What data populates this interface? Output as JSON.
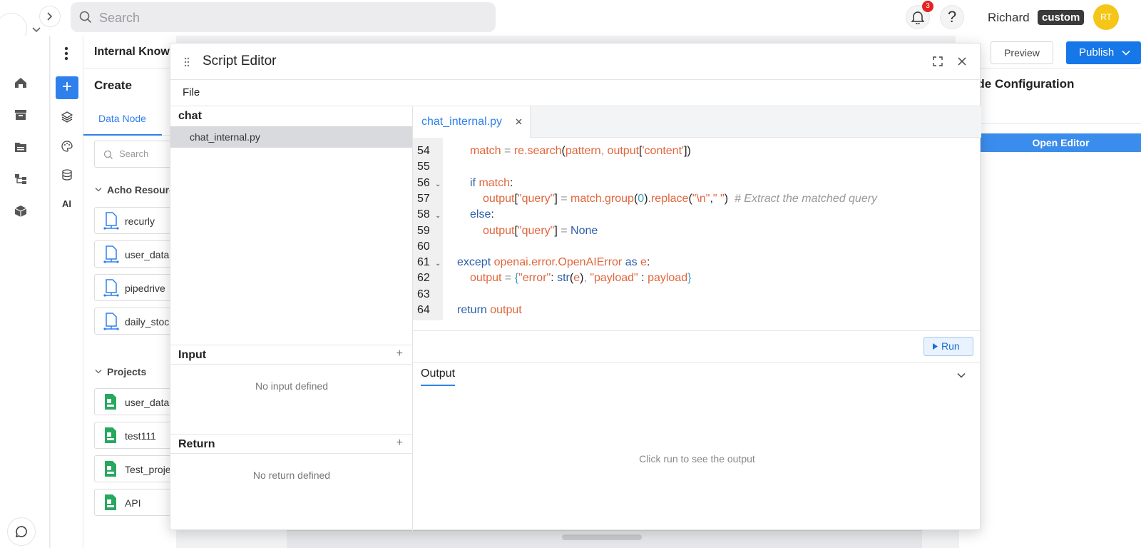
{
  "topbar": {
    "search_placeholder": "Search",
    "notifications_count": "3",
    "user_name": "Richard",
    "user_tag": "custom",
    "avatar_initials": "RT"
  },
  "app": {
    "title": "Internal Knowle",
    "create_label": "Create",
    "tab_data_node": "Data Node",
    "panel_search_placeholder": "Search"
  },
  "resources": {
    "header": "Acho Resources",
    "items": [
      "recurly",
      "user_data",
      "pipedrive",
      "daily_stoc"
    ]
  },
  "projects": {
    "header": "Projects",
    "items": [
      "user_data",
      "test111",
      "Test_proje",
      "API"
    ]
  },
  "rail2": {
    "ai_label": "AI"
  },
  "right": {
    "preview": "Preview",
    "publish": "Publish",
    "node_config": "ode Configuration",
    "open_editor": "Open Editor"
  },
  "editor": {
    "title": "Script Editor",
    "menu_file": "File",
    "folder": "chat",
    "file": "chat_internal.py",
    "tab_file": "chat_internal.py",
    "input_header": "Input",
    "input_empty": "No input defined",
    "return_header": "Return",
    "return_empty": "No return defined",
    "run": "Run",
    "output_tab": "Output",
    "output_placeholder": "Click run to see the output",
    "line_numbers": [
      "54",
      "55",
      "56",
      "57",
      "58",
      "59",
      "60",
      "61",
      "62",
      "63",
      "64"
    ],
    "lines": [
      {
        "indent": 1,
        "tokens": [
          [
            "v",
            "match"
          ],
          [
            "g",
            " = "
          ],
          [
            "v",
            "re.search"
          ],
          [
            "d",
            "("
          ],
          [
            "v",
            "pattern"
          ],
          [
            "g",
            ", "
          ],
          [
            "v",
            "output"
          ],
          [
            "d",
            "["
          ],
          [
            "s",
            "'content'"
          ],
          [
            "d",
            "])"
          ]
        ]
      },
      {
        "indent": 0,
        "tokens": []
      },
      {
        "indent": 1,
        "tokens": [
          [
            "k",
            "if "
          ],
          [
            "v",
            "match"
          ],
          [
            "d",
            ":"
          ]
        ]
      },
      {
        "indent": 2,
        "tokens": [
          [
            "v",
            "output"
          ],
          [
            "d",
            "["
          ],
          [
            "s",
            "\"query\""
          ],
          [
            "d",
            "]"
          ],
          [
            "g",
            " = "
          ],
          [
            "v",
            "match.group"
          ],
          [
            "d",
            "("
          ],
          [
            "n",
            "0"
          ],
          [
            "d",
            ")"
          ],
          [
            "v",
            ".replace"
          ],
          [
            "d",
            "("
          ],
          [
            "s",
            "\"\\n\""
          ],
          [
            "d",
            ","
          ],
          [
            "s",
            "\" \""
          ],
          [
            "d",
            ")"
          ],
          [
            "c",
            "  # Extract the matched query"
          ]
        ]
      },
      {
        "indent": 1,
        "tokens": [
          [
            "k",
            "else"
          ],
          [
            "d",
            ":"
          ]
        ]
      },
      {
        "indent": 2,
        "tokens": [
          [
            "v",
            "output"
          ],
          [
            "d",
            "["
          ],
          [
            "s",
            "\"query\""
          ],
          [
            "d",
            "]"
          ],
          [
            "g",
            " = "
          ],
          [
            "k",
            "None"
          ]
        ]
      },
      {
        "indent": 0,
        "tokens": []
      },
      {
        "indent": 0,
        "tokens": [
          [
            "k",
            "except "
          ],
          [
            "v",
            "openai.error.OpenAIError"
          ],
          [
            "k",
            " as "
          ],
          [
            "v",
            "e"
          ],
          [
            "d",
            ":"
          ]
        ]
      },
      {
        "indent": 1,
        "tokens": [
          [
            "v",
            "output"
          ],
          [
            "g",
            " = "
          ],
          [
            "n",
            "{"
          ],
          [
            "s",
            "\"error\""
          ],
          [
            "d",
            ": "
          ],
          [
            "k",
            "str"
          ],
          [
            "d",
            "("
          ],
          [
            "v",
            "e"
          ],
          [
            "d",
            ")"
          ],
          [
            "g",
            ", "
          ],
          [
            "s",
            "\"payload\""
          ],
          [
            "d",
            " : "
          ],
          [
            "v",
            "payload"
          ],
          [
            "n",
            "}"
          ]
        ]
      },
      {
        "indent": 0,
        "tokens": []
      },
      {
        "indent": 0,
        "tokens": [
          [
            "k",
            "return "
          ],
          [
            "v",
            "output"
          ]
        ]
      }
    ],
    "fold_lines": [
      2,
      4,
      7
    ]
  }
}
